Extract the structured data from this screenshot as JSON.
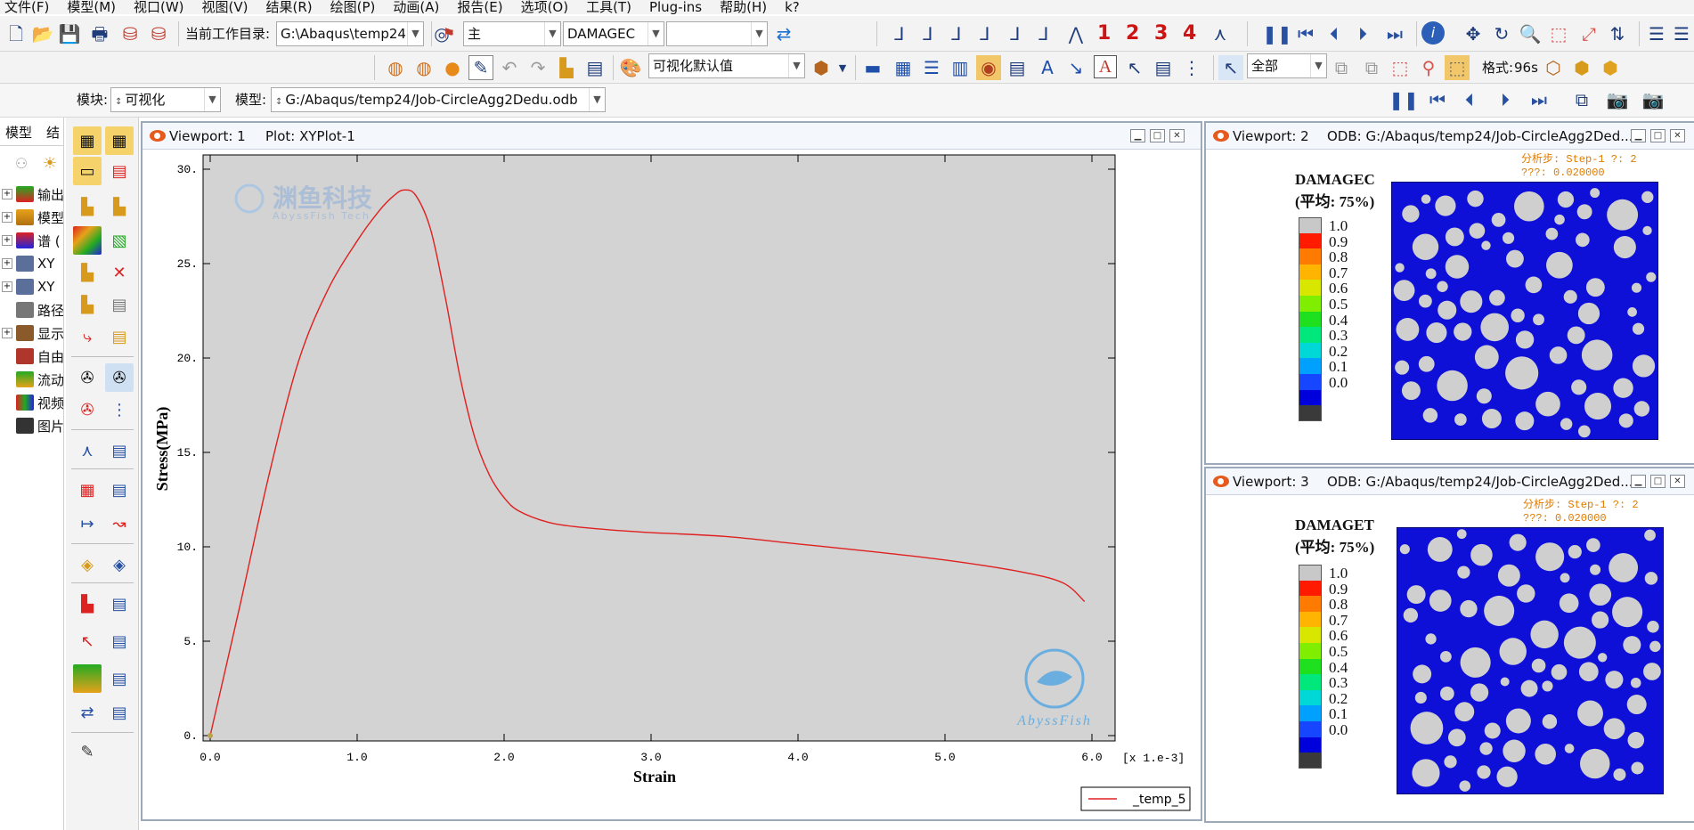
{
  "menu": [
    "文件(F)",
    "模型(M)",
    "视口(W)",
    "视图(V)",
    "结果(R)",
    "绘图(P)",
    "动画(A)",
    "报告(E)",
    "选项(O)",
    "工具(T)",
    "Plug-ins",
    "帮助(H)",
    "k?"
  ],
  "toolbar1": {
    "workdir_label": "当前工作目录:",
    "workdir_value": "G:\\Abaqus\\temp24",
    "primary_value": "主",
    "variable_value": "DAMAGEC",
    "extra_value": "",
    "numbers": [
      "1",
      "2",
      "3",
      "4"
    ]
  },
  "toolbar2": {
    "viz_default": "可视化默认值",
    "select_all": "全部",
    "format_label": "格式:",
    "format_value": "96s"
  },
  "context": {
    "module_label": "模块:",
    "module_value": "可视化",
    "model_label": "模型:",
    "model_value": "G:/Abaqus/temp24/Job-CircleAgg2Dedu.odb"
  },
  "tree": {
    "tabs": [
      "模型",
      "结"
    ],
    "items": [
      "输出",
      "模型",
      "谱 (",
      "XY",
      "XY",
      "路径",
      "显示",
      "自由",
      "流动",
      "视频",
      "图片"
    ]
  },
  "viewport1": {
    "title": "Viewport: 1",
    "plot_name": "Plot: XYPlot-1",
    "watermark_cn": "渊鱼科技",
    "watermark_en": "AbyssFish Tech",
    "logo_text": "AbyssFish",
    "legend_entry": "_temp_5",
    "x_multiplier": "[x 1.e-3]"
  },
  "chart_data": {
    "type": "line",
    "title": "",
    "xlabel": "Strain",
    "ylabel": "Stress(MPa)",
    "xlim": [
      0,
      6.0
    ],
    "ylim": [
      0,
      30
    ],
    "x_ticks": [
      "0.0",
      "1.0",
      "2.0",
      "3.0",
      "4.0",
      "5.0",
      "6.0"
    ],
    "y_ticks": [
      "0.",
      "5.",
      "10.",
      "15.",
      "20.",
      "25.",
      "30."
    ],
    "grid": false,
    "legend_position": "bottom-right",
    "series": [
      {
        "name": "_temp_5",
        "color": "#e02020",
        "x": [
          0,
          0.2,
          0.4,
          0.6,
          0.8,
          1.0,
          1.15,
          1.25,
          1.32,
          1.4,
          1.5,
          1.6,
          1.7,
          1.8,
          1.9,
          2.0,
          2.1,
          2.3,
          2.5,
          2.8,
          3.0,
          3.5,
          4.0,
          4.5,
          5.0,
          5.5,
          5.8,
          5.95
        ],
        "y": [
          0,
          6.8,
          13.8,
          19.8,
          23.6,
          26.2,
          27.8,
          28.6,
          28.9,
          28.6,
          26.8,
          23.2,
          19.0,
          15.8,
          13.8,
          12.6,
          11.9,
          11.3,
          11.05,
          10.85,
          10.75,
          10.55,
          10.15,
          9.75,
          9.3,
          8.7,
          8.1,
          7.1
        ]
      }
    ]
  },
  "viewport2": {
    "title": "Viewport: 2",
    "odb": "ODB: G:/Abaqus/temp24/Job-CircleAgg2Ded...",
    "step_text": "分析步: Step-1   ?: 2",
    "time_text": "???: 0.020000",
    "field": "DAMAGEC",
    "avg": "(平均: 75%)",
    "legend_values": [
      "1.0",
      "0.9",
      "0.8",
      "0.7",
      "0.6",
      "0.5",
      "0.4",
      "0.3",
      "0.2",
      "0.1",
      "0.0"
    ]
  },
  "viewport3": {
    "title": "Viewport: 3",
    "odb": "ODB: G:/Abaqus/temp24/Job-CircleAgg2Ded...",
    "step_text": "分析步: Step-1   ?: 2",
    "time_text": "???: 0.020000",
    "field": "DAMAGET",
    "avg": "(平均: 75%)",
    "legend_values": [
      "1.0",
      "0.9",
      "0.8",
      "0.7",
      "0.6",
      "0.5",
      "0.4",
      "0.3",
      "0.2",
      "0.1",
      "0.0"
    ]
  },
  "colors": {
    "contour": [
      "#c8c8c8",
      "#ff1a00",
      "#ff7a00",
      "#ffb400",
      "#d8e600",
      "#7fee00",
      "#1fe01f",
      "#00e87c",
      "#00d8d8",
      "#00a0ff",
      "#1646ff",
      "#0000dc",
      "#3a3a3a"
    ],
    "plot_bg": "#d3d3d3",
    "curve": "#e02020",
    "mesh_blue": "#0e10d8"
  }
}
